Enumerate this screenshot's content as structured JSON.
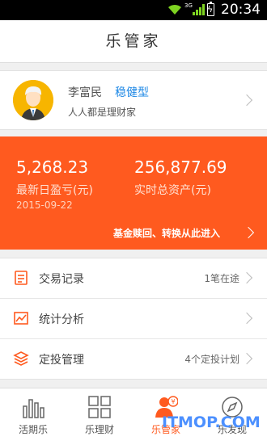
{
  "status_bar": {
    "time": "20:34",
    "network_label": "3G"
  },
  "header": {
    "title": "乐管家"
  },
  "profile": {
    "name": "李富民",
    "risk_type": "稳健型",
    "motto": "人人都是理财家"
  },
  "summary": {
    "daily_profit_value": "5,268.23",
    "daily_profit_label": "最新日盈亏(元)",
    "date": "2015-09-22",
    "total_assets_value": "256,877.69",
    "total_assets_label": "实时总资产(元)",
    "action_text": "基金赎回、转换从此进入"
  },
  "menu": [
    {
      "label": "交易记录",
      "info": "1笔在途",
      "icon": "document-icon"
    },
    {
      "label": "统计分析",
      "info": "",
      "icon": "line-chart-icon"
    },
    {
      "label": "定投管理",
      "info": "4个定投计划",
      "icon": "stack-layers-icon"
    }
  ],
  "tabs": [
    {
      "label": "活期乐",
      "icon": "bar-chart-icon",
      "active": false
    },
    {
      "label": "乐理财",
      "icon": "grid-icon",
      "active": false
    },
    {
      "label": "乐管家",
      "icon": "user-yen-icon",
      "active": true
    },
    {
      "label": "乐发现",
      "icon": "compass-icon",
      "active": false
    }
  ],
  "watermark": {
    "text": "ITMOP.COM"
  },
  "colors": {
    "accent": "#ff5a1f",
    "link_blue": "#1e88e5",
    "page_bg": "#f0f0f0"
  }
}
